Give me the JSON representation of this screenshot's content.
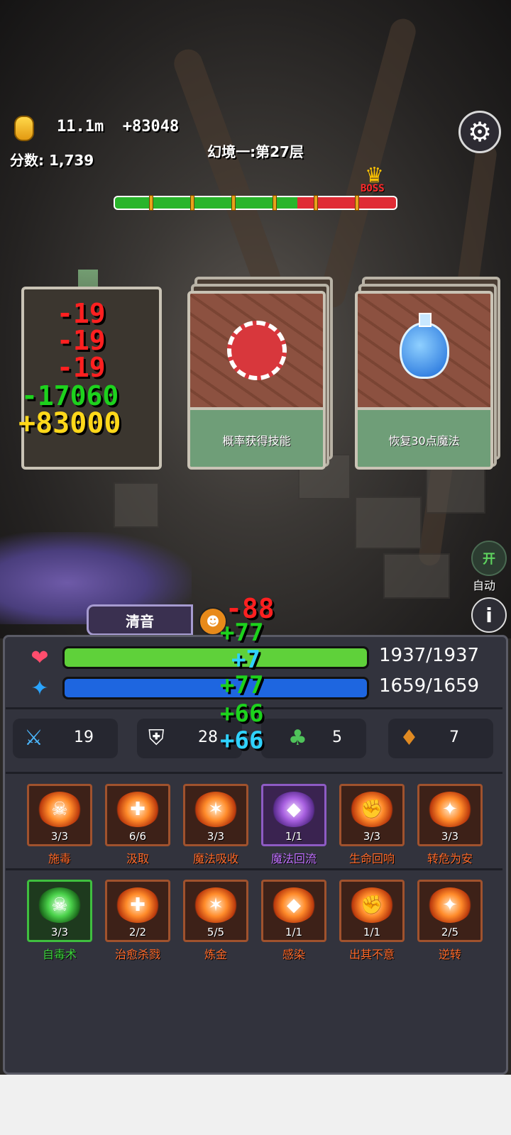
{
  "hud": {
    "gold": "11.1m",
    "gold_gain": "+83048",
    "score": "分数: 1,739",
    "stage": "幻境一:第27层",
    "boss_label": "BOSS",
    "settings_icon": "gear-icon",
    "boss_progress": 0.65
  },
  "cards": [
    {
      "label": "概率获得技能",
      "icon": "poker-chip-icon"
    },
    {
      "label": "恢复30点魔法",
      "icon": "mana-potion-icon"
    }
  ],
  "floating_numbers": {
    "card": [
      "-19",
      "-19",
      "-19",
      "-17060",
      "+83000"
    ],
    "hero": [
      "-88",
      "+77",
      "+7",
      "+77",
      "+66",
      "+66"
    ]
  },
  "hero": {
    "name": "清音",
    "hp": "1937/1937",
    "mp": "1659/1659",
    "hp_ratio": 1.0,
    "mp_ratio": 1.0
  },
  "side_buttons": {
    "auto_toggle": "开",
    "auto_label": "自动",
    "info": "i"
  },
  "stats": [
    {
      "icon": "sword-icon",
      "value": "19"
    },
    {
      "icon": "shield-icon",
      "value": "28"
    },
    {
      "icon": "clover-icon",
      "value": "5"
    },
    {
      "icon": "money-bag-icon",
      "value": "7"
    }
  ],
  "skills_row1": [
    {
      "name": "施毒",
      "level": "3/3",
      "style": "orange"
    },
    {
      "name": "汲取",
      "level": "6/6",
      "style": "orange"
    },
    {
      "name": "魔法吸收",
      "level": "3/3",
      "style": "orange"
    },
    {
      "name": "魔法回流",
      "level": "1/1",
      "style": "purple"
    },
    {
      "name": "生命回响",
      "level": "3/3",
      "style": "orange"
    },
    {
      "name": "转危为安",
      "level": "3/3",
      "style": "orange"
    }
  ],
  "skills_row2": [
    {
      "name": "自毒术",
      "level": "3/3",
      "style": "green"
    },
    {
      "name": "治愈杀戮",
      "level": "2/2",
      "style": "orange"
    },
    {
      "name": "炼金",
      "level": "5/5",
      "style": "orange"
    },
    {
      "name": "感染",
      "level": "1/1",
      "style": "orange"
    },
    {
      "name": "出其不意",
      "level": "1/1",
      "style": "orange"
    },
    {
      "name": "逆转",
      "level": "2/5",
      "style": "orange"
    }
  ],
  "colors": {
    "hp_bar": "#5fd13a",
    "mp_bar": "#1e66e0",
    "progress_green": "#29b52b",
    "progress_red": "#e02c35"
  }
}
